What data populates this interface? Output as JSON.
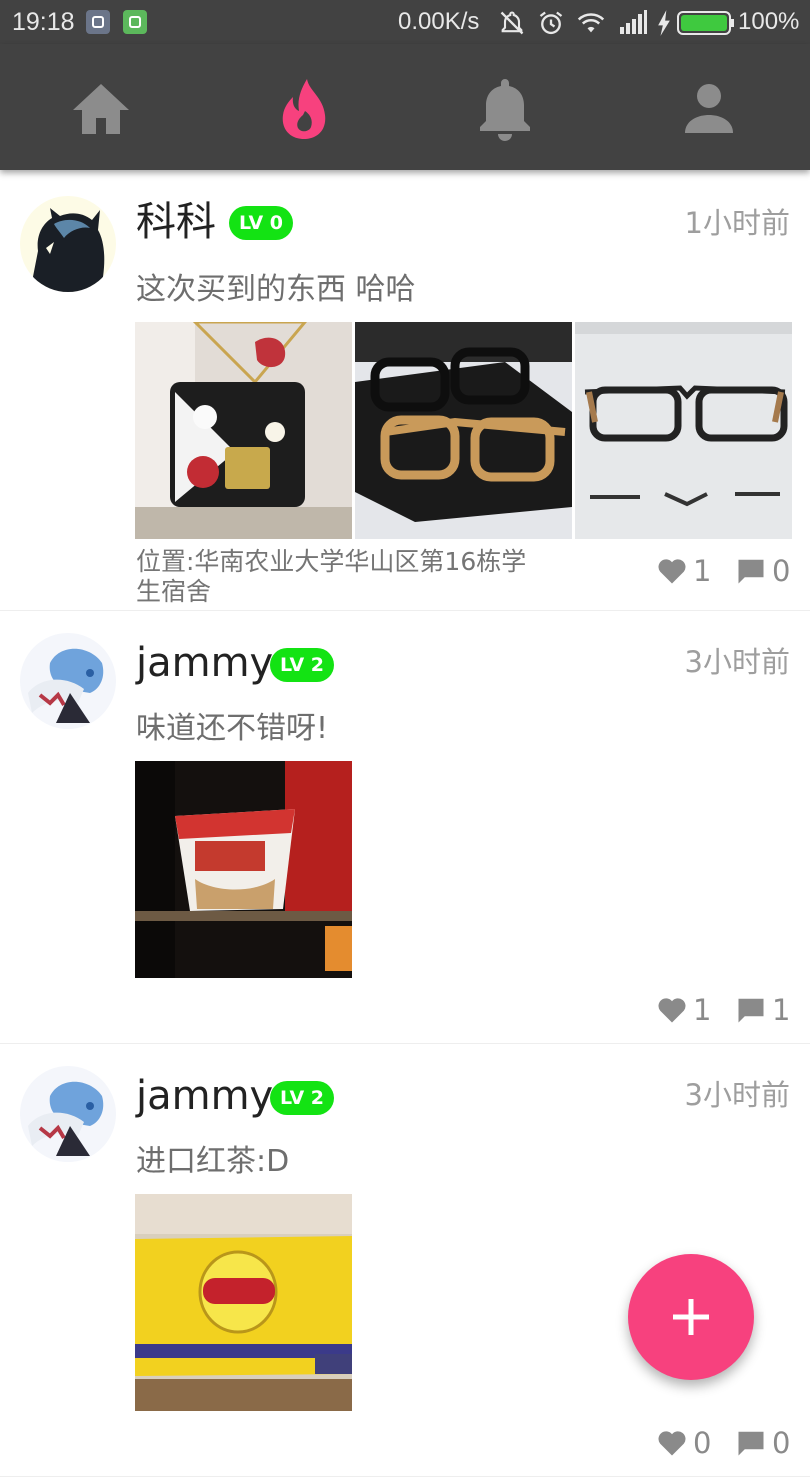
{
  "status_bar": {
    "time": "19:18",
    "net_speed": "0.00K/s",
    "battery": "100%"
  },
  "nav": {
    "tabs": [
      {
        "name": "home",
        "icon": "home-icon",
        "active": false
      },
      {
        "name": "hot",
        "icon": "flame-icon",
        "active": true
      },
      {
        "name": "notifications",
        "icon": "bell-icon",
        "active": false
      },
      {
        "name": "profile",
        "icon": "person-icon",
        "active": false
      }
    ],
    "active_color": "#f7417e",
    "inactive_color": "#8c8c8c"
  },
  "posts": [
    {
      "username": "科科",
      "level": "LV 0",
      "time": "1小时前",
      "content": "这次买到的东西 哈哈",
      "images": [
        "handbag-photo",
        "glasses-box-photo",
        "glasses-page-photo"
      ],
      "location": "位置:华南农业大学华山区第16栋学生宿舍",
      "likes": "1",
      "comments": "0"
    },
    {
      "username": "jammy",
      "level": "LV 2",
      "time": "3小时前",
      "content": "味道还不错呀!",
      "images": [
        "noodle-cup-photo"
      ],
      "location": "",
      "likes": "1",
      "comments": "1"
    },
    {
      "username": "jammy",
      "level": "LV 2",
      "time": "3小时前",
      "content": "进口红茶:D",
      "images": [
        "lipton-box-photo"
      ],
      "location": "",
      "likes": "0",
      "comments": "0"
    }
  ],
  "fab": {
    "icon": "plus-icon",
    "color": "#f7417e"
  },
  "colors": {
    "toolbar": "#424242",
    "level_badge": "#13e313"
  }
}
